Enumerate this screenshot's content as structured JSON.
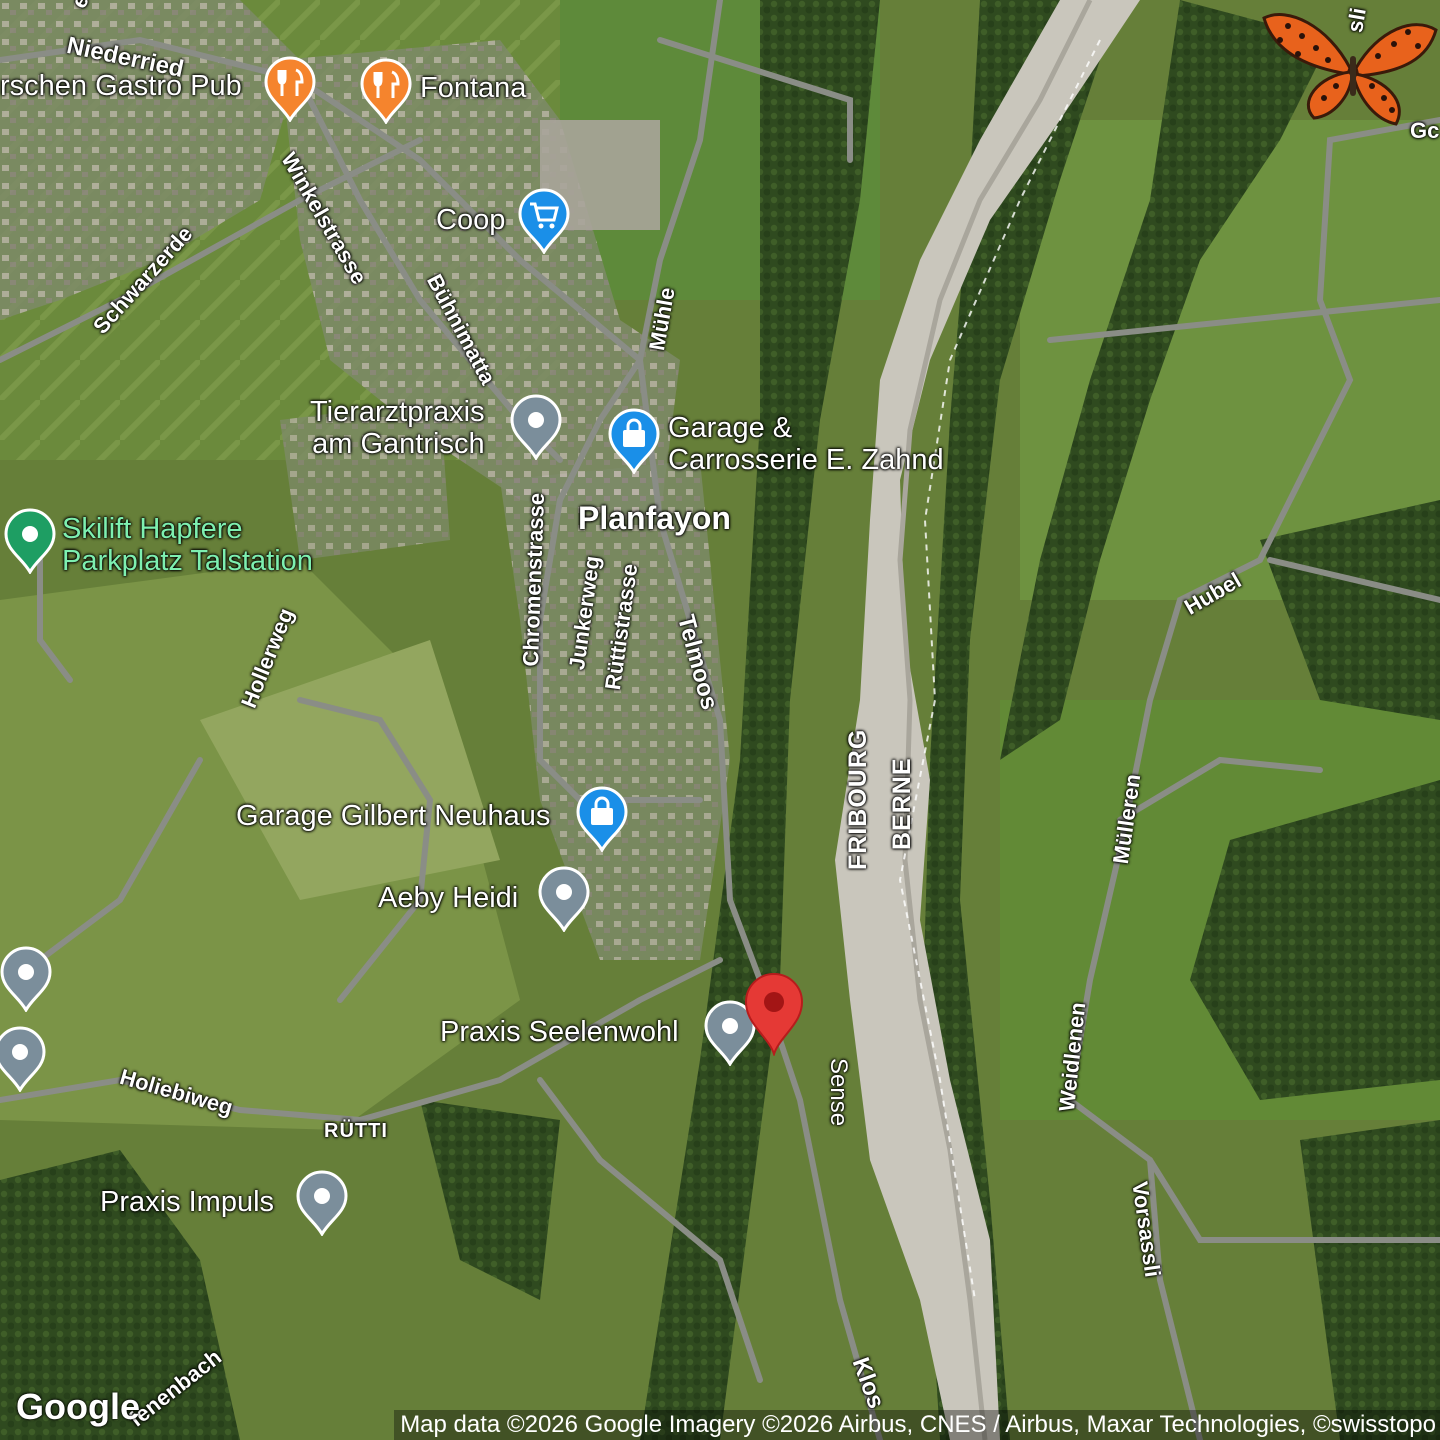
{
  "map": {
    "town": "Planfayon",
    "hamlet": "RÜTTI",
    "border_labels": [
      "FRIBOURG",
      "BERNE"
    ],
    "river": "Sense",
    "pois": [
      {
        "name": "Wirtschaften Gastro Pub",
        "shown": "rschen Gastro Pub",
        "icon": "restaurant-icon",
        "color": "#f5842d"
      },
      {
        "name": "Fontana",
        "icon": "restaurant-icon",
        "color": "#f5842d"
      },
      {
        "name": "Coop",
        "icon": "shopping-cart-icon",
        "color": "#1a8fe8"
      },
      {
        "name": "Tierarztpraxis am Gantrisch",
        "line1": "Tierarztpraxis",
        "line2": "am Gantrisch",
        "icon": "generic-pin-icon",
        "color": "#7b8e9b"
      },
      {
        "name": "Garage & Carrosserie E. Zahnd",
        "line1": "Garage &",
        "line2": "Carrosserie E. Zahnd",
        "icon": "shopping-bag-icon",
        "color": "#1a8fe8"
      },
      {
        "name": "Skilift Hapfere Parkplatz Talstation",
        "line1": "Skilift Hapfere",
        "line2": "Parkplatz Talstation",
        "icon": "park-pin-icon",
        "color": "#1e9e63"
      },
      {
        "name": "Garage Gilbert Neuhaus",
        "icon": "shopping-bag-icon",
        "color": "#1a8fe8"
      },
      {
        "name": "Aeby Heidi",
        "icon": "generic-pin-icon",
        "color": "#7b8e9b"
      },
      {
        "name": "Praxis Seelenwohl",
        "icon": "generic-pin-icon",
        "color": "#7b8e9b"
      },
      {
        "name": "Praxis Impuls",
        "icon": "generic-pin-icon",
        "color": "#7b8e9b"
      }
    ],
    "roads": [
      "Niederried",
      "Winkelstrasse",
      "Schwarzerde",
      "Bühnimatta",
      "Mühle",
      "Chromenstrasse",
      "Junkerweg",
      "Rüttistrasse",
      "Telmoos",
      "Hollerweg",
      "Holiebiweg",
      "Hubel",
      "Mülleren",
      "Weidlenen",
      "Vorsassli",
      "Klos",
      "fenenbach",
      "Gc",
      "ed",
      "sli"
    ],
    "selected_marker": {
      "icon": "red-location-marker-icon",
      "color": "#e53935"
    }
  },
  "footer": {
    "logo": "Google",
    "attribution": "Map data ©2026 Google Imagery ©2026 Airbus, CNES / Airbus, Maxar Technologies, ©swisstopo"
  },
  "overlay": {
    "icon": "butterfly-icon"
  }
}
